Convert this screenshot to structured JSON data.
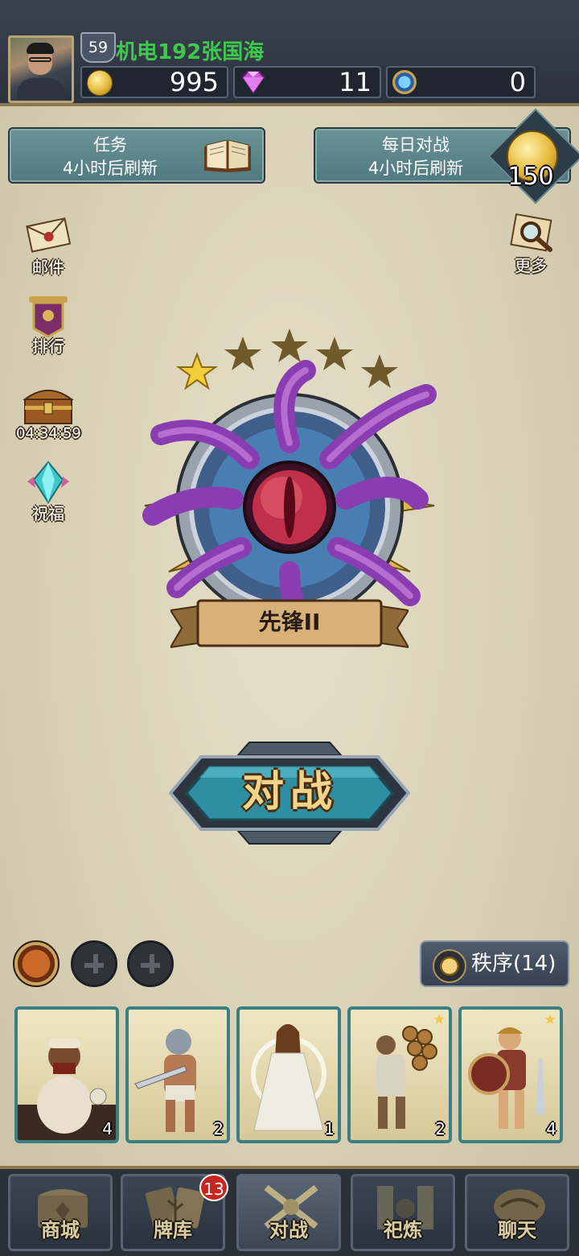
{
  "player": {
    "name": "机电192张国海",
    "level": "59"
  },
  "resources": {
    "gold": "995",
    "gems": "11",
    "runes": "0"
  },
  "quest_panel": {
    "title": "任务",
    "subtitle": "4小时后刷新"
  },
  "daily_panel": {
    "title": "每日对战",
    "subtitle": "4小时后刷新",
    "reward": "150"
  },
  "side_menu": {
    "mail": "邮件",
    "ranking": "排行",
    "chest_timer": "04:34:59",
    "blessing": "祝福",
    "more": "更多"
  },
  "rank": {
    "name": "先锋II",
    "stars_filled": 1,
    "stars_total": 5
  },
  "battle_button": "对战",
  "order_button": "秩序(14)",
  "cards": [
    {
      "count": "4",
      "starred": false
    },
    {
      "count": "2",
      "starred": false
    },
    {
      "count": "1",
      "starred": false
    },
    {
      "count": "2",
      "starred": true
    },
    {
      "count": "4",
      "starred": true
    }
  ],
  "bottom_nav": {
    "shop": "商城",
    "deck": "牌库",
    "deck_badge": "13",
    "battle": "对战",
    "forge": "祀炼",
    "chat": "聊天"
  },
  "colors": {
    "username": "#3ec94d",
    "panel_teal": "#5f8a8f",
    "badge_red": "#c7261f"
  }
}
